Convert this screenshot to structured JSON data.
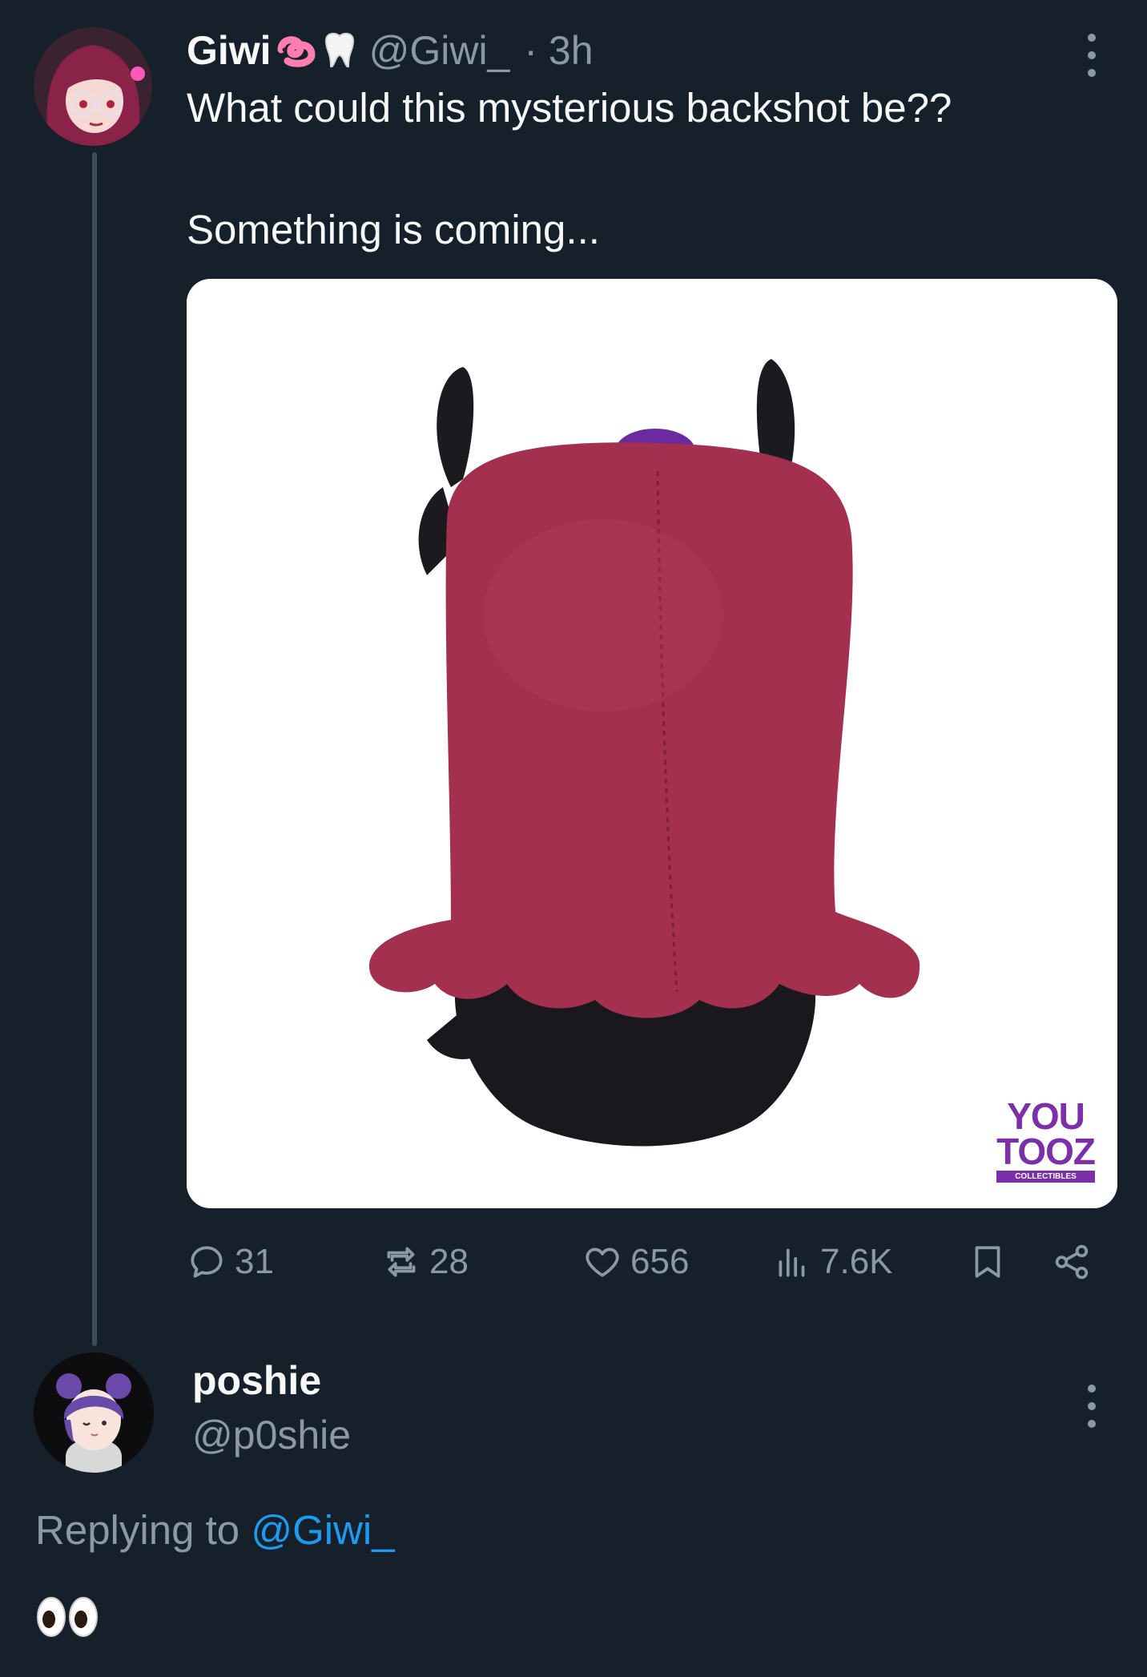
{
  "tweet": {
    "author_name": "Giwi",
    "author_handle": "@Giwi_",
    "time": "· 3h",
    "line1": "What could this mysterious backshot be??",
    "line2": "Something is coming...",
    "name_emojis": [
      "worm-emoji",
      "tooth-emoji"
    ],
    "media_logo": {
      "line1": "YOU",
      "line2": "TOOZ",
      "line3": "COLLECTIBLES"
    },
    "actions": {
      "replies": "31",
      "retweets": "28",
      "likes": "656",
      "views": "7.6K"
    }
  },
  "reply": {
    "author_name": "poshie",
    "author_handle": "@p0shie",
    "replying_prefix": "Replying to",
    "replying_to": "@Giwi_",
    "content": "👀"
  },
  "colors": {
    "background": "#15202b",
    "secondary_text": "#8b98a5",
    "link": "#1d9bf0",
    "plush_hair": "#a3304f",
    "plush_horns": "#1c1a1f",
    "logo_purple": "#7b2fa8"
  }
}
